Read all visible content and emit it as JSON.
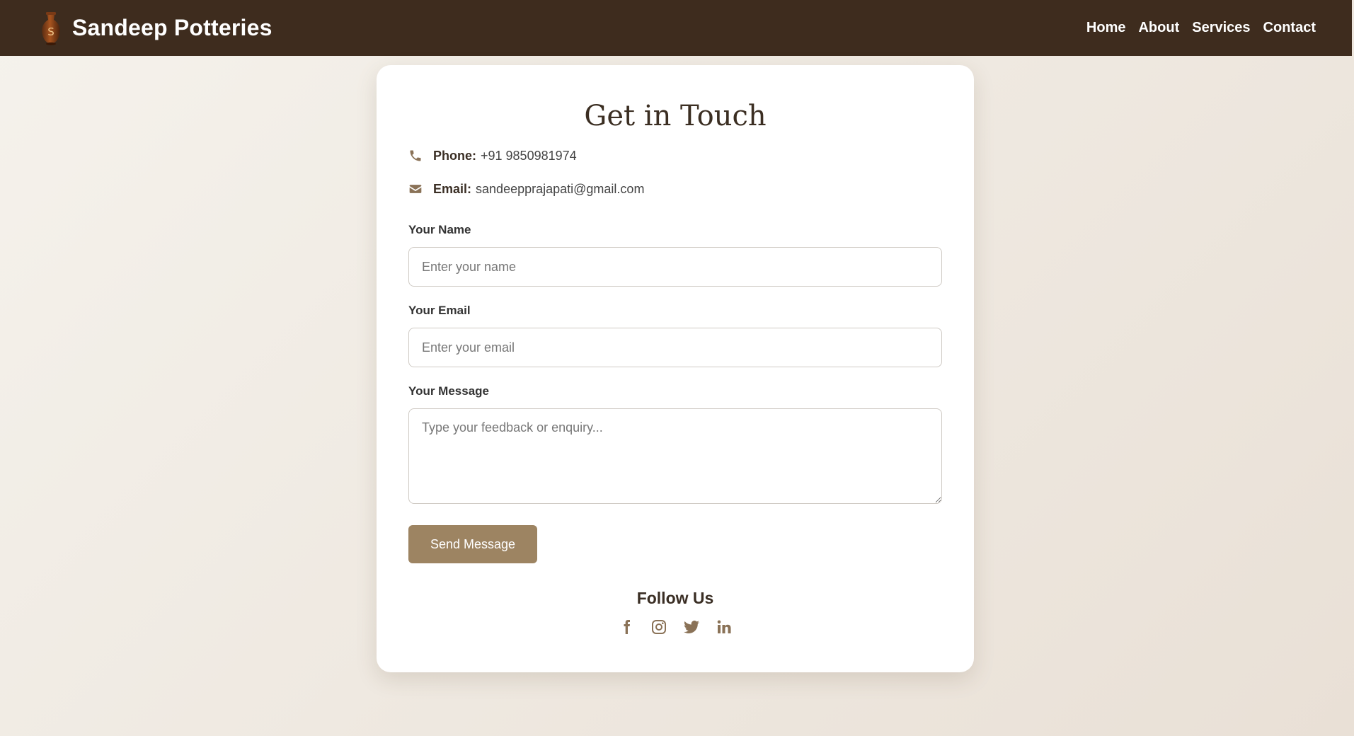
{
  "navbar": {
    "logo_letter": "S",
    "brand": "Sandeep Potteries",
    "links": [
      "Home",
      "About",
      "Services",
      "Contact"
    ]
  },
  "contact": {
    "title": "Get in Touch",
    "phone_label": "Phone:",
    "phone_value": "+91 9850981974",
    "email_label": "Email:",
    "email_value": "sandeepprajapati@gmail.com"
  },
  "form": {
    "name_label": "Your Name",
    "name_placeholder": "Enter your name",
    "email_label": "Your Email",
    "email_placeholder": "Enter your email",
    "message_label": "Your Message",
    "message_placeholder": "Type your feedback or enquiry...",
    "submit_label": "Send Message"
  },
  "follow": {
    "title": "Follow Us",
    "icons": [
      "facebook-icon",
      "instagram-icon",
      "twitter-icon",
      "linkedin-icon"
    ]
  },
  "colors": {
    "navbar_bg": "#3e2c1e",
    "accent": "#9d8462",
    "icon": "#8a7257"
  }
}
